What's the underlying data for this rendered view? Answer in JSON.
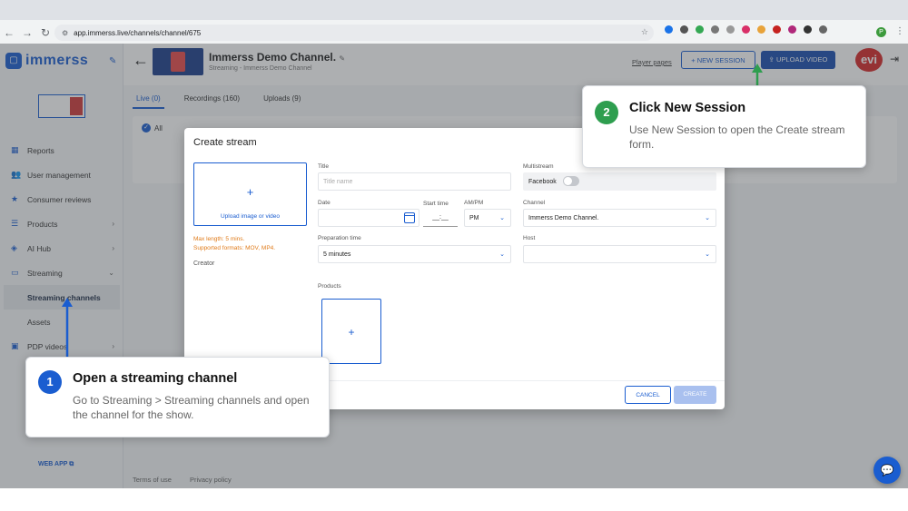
{
  "browser": {
    "url": "app.immerss.live/channels/channel/675",
    "profile_initial": "P"
  },
  "sidebar": {
    "logo_text": "immerss",
    "items": [
      {
        "label": "Reports",
        "icon": "reports-icon",
        "glyph": "▦"
      },
      {
        "label": "User management",
        "icon": "users-icon",
        "glyph": "👥"
      },
      {
        "label": "Consumer reviews",
        "icon": "star-icon",
        "glyph": "★"
      },
      {
        "label": "Products",
        "icon": "list-icon",
        "glyph": "☰"
      },
      {
        "label": "AI Hub",
        "icon": "ai-icon",
        "glyph": "◈"
      },
      {
        "label": "Streaming",
        "icon": "monitor-icon",
        "glyph": "▭"
      }
    ],
    "sub_items": [
      "Streaming channels",
      "Assets"
    ],
    "pdp_label": "PDP videos",
    "web_app": "WEB APP"
  },
  "header": {
    "channel_title": "Immerss Demo Channel.",
    "channel_subtitle": "Streaming - Immerss Demo Channel",
    "player_pages": "Player pages",
    "new_session": "+ NEW SESSION",
    "upload_video": "⇪ UPLOAD VIDEO",
    "avatar_text": "evi"
  },
  "tabs": [
    "Live (0)",
    "Recordings (160)",
    "Uploads (9)"
  ],
  "filters": {
    "all": "All"
  },
  "footer": {
    "terms": "Terms of use",
    "privacy": "Privacy policy"
  },
  "modal": {
    "title": "Create stream",
    "upload_label": "Upload image or video",
    "max_length": "Max length: 5 mins.",
    "formats": "Supported formats: MOV, MP4.",
    "creator_label": "Creator",
    "title_label": "Title",
    "title_placeholder": "Title name",
    "date_label": "Date",
    "start_time_label": "Start time",
    "start_time_value": "__:__",
    "ampm_label": "AM/PM",
    "ampm_value": "PM",
    "prep_label": "Preparation time",
    "prep_value": "5 minutes",
    "multistream_label": "Multistream",
    "facebook_label": "Facebook",
    "channel_label": "Channel",
    "channel_value": "Immerss Demo Channel.",
    "host_label": "Host",
    "products_label": "Products",
    "cancel": "CANCEL",
    "create": "CREATE"
  },
  "callouts": [
    {
      "number": "1",
      "title": "Open a streaming channel",
      "desc": "Go to Streaming > Streaming channels and open the channel for the show.",
      "color": "#1a5dd0"
    },
    {
      "number": "2",
      "title": "Click New Session",
      "desc": "Use New Session to open the Create stream form.",
      "color": "#2e9e4f"
    }
  ],
  "colors": {
    "brand": "#1a5dd0",
    "warning": "#e07b1a"
  }
}
